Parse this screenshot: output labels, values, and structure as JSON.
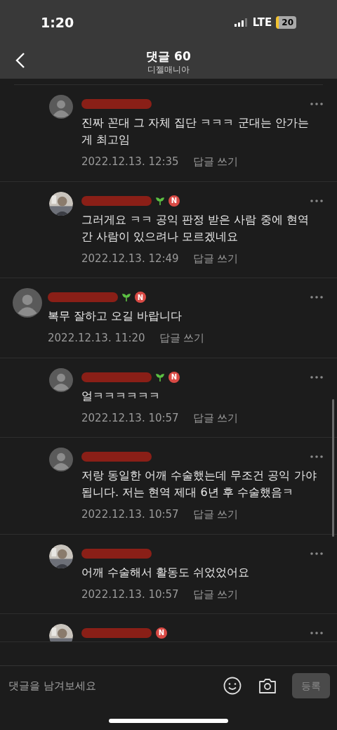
{
  "status_bar": {
    "time": "1:20",
    "network": "LTE",
    "battery": "20"
  },
  "header": {
    "title": "댓글 60",
    "subtitle": "디젤매니아"
  },
  "comments": [
    {
      "kind": "reply",
      "photo_avatar": false,
      "sprout": false,
      "text": "진짜 꼰대 그 자체 집단 ㅋㅋㅋ 군대는 안가는 게 최고임",
      "date": "2022.12.13. 12:35",
      "reply_label": "답글 쓰기"
    },
    {
      "kind": "reply",
      "photo_avatar": true,
      "sprout": true,
      "badge": "N",
      "text": "그러게요 ㅋㅋ 공익 판정 받은 사람 중에 현역 간 사람이 있으려나 모르겠네요",
      "date": "2022.12.13. 12:49",
      "reply_label": "답글 쓰기"
    },
    {
      "kind": "comment",
      "photo_avatar": false,
      "sprout": true,
      "badge": "N",
      "text": "복무 잘하고 오길 바랍니다",
      "date": "2022.12.13. 11:20",
      "reply_label": "답글 쓰기"
    },
    {
      "kind": "reply",
      "photo_avatar": false,
      "sprout": true,
      "badge": "N",
      "text": "얼ㅋㅋㅋㅋㅋㅋ",
      "date": "2022.12.13. 10:57",
      "reply_label": "답글 쓰기"
    },
    {
      "kind": "reply",
      "photo_avatar": false,
      "sprout": false,
      "text": "저랑 동일한 어깨 수술했는데 무조건 공익 가야 됩니다.  저는 현역 제대 6년 후  수술했음ㅋ",
      "date": "2022.12.13. 10:57",
      "reply_label": "답글 쓰기"
    },
    {
      "kind": "reply",
      "photo_avatar": true,
      "sprout": false,
      "text": "어깨 수술해서 활동도 쉬었었어요",
      "date": "2022.12.13. 10:57",
      "reply_label": "답글 쓰기"
    },
    {
      "kind": "reply",
      "photo_avatar": true,
      "sprout": false,
      "badge": "N"
    }
  ],
  "composer": {
    "placeholder": "댓글을 남겨보세요",
    "submit": "등록"
  }
}
